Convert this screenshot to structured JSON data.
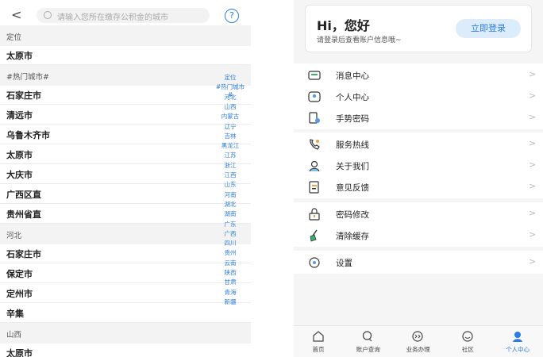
{
  "left": {
    "search": {
      "placeholder": "请输入您所在缴存公积金的城市",
      "help": "?",
      "back": "<"
    },
    "list": [
      {
        "kind": "header",
        "label": "定位"
      },
      {
        "kind": "city",
        "label": "太原市"
      },
      {
        "kind": "header",
        "label": "#热门城市#"
      },
      {
        "kind": "city",
        "label": "石家庄市"
      },
      {
        "kind": "city",
        "label": "清远市"
      },
      {
        "kind": "city",
        "label": "乌鲁木齐市"
      },
      {
        "kind": "city",
        "label": "太原市"
      },
      {
        "kind": "city",
        "label": "大庆市"
      },
      {
        "kind": "city",
        "label": "广西区直"
      },
      {
        "kind": "city",
        "label": "贵州省直"
      },
      {
        "kind": "header",
        "label": "河北"
      },
      {
        "kind": "city",
        "label": "石家庄市"
      },
      {
        "kind": "city",
        "label": "保定市"
      },
      {
        "kind": "city",
        "label": "定州市"
      },
      {
        "kind": "city",
        "label": "辛集"
      },
      {
        "kind": "header",
        "label": "山西"
      },
      {
        "kind": "city",
        "label": "太原市"
      }
    ],
    "index_bar": [
      "定位",
      "#热门城市#",
      "河北",
      "山西",
      "内蒙古",
      "辽宁",
      "吉林",
      "黑龙江",
      "江苏",
      "浙江",
      "江西",
      "山东",
      "河南",
      "湖北",
      "湖南",
      "广东",
      "广西",
      "四川",
      "贵州",
      "云南",
      "陕西",
      "甘肃",
      "青海",
      "新疆"
    ]
  },
  "right": {
    "greeting": "Hi，您好",
    "greeting_sub": "请登录后查看账户信息哦~",
    "login_button": "立即登录",
    "groups": [
      [
        {
          "label": "消息中心",
          "icon": "message-icon"
        },
        {
          "label": "个人中心",
          "icon": "person-icon"
        },
        {
          "label": "手势密码",
          "icon": "gesture-password-icon"
        }
      ],
      [
        {
          "label": "服务热线",
          "icon": "phone-icon"
        },
        {
          "label": "关于我们",
          "icon": "about-icon"
        },
        {
          "label": "意见反馈",
          "icon": "feedback-icon"
        }
      ],
      [
        {
          "label": "密码修改",
          "icon": "lock-icon"
        },
        {
          "label": "清除缓存",
          "icon": "broom-icon"
        }
      ],
      [
        {
          "label": "设置",
          "icon": "settings-icon"
        }
      ]
    ],
    "chevron": ">",
    "tabs": [
      {
        "label": "首页",
        "icon": "home-icon",
        "active": false
      },
      {
        "label": "账户查询",
        "icon": "search-icon",
        "active": false
      },
      {
        "label": "业务办理",
        "icon": "business-icon",
        "active": false
      },
      {
        "label": "社区",
        "icon": "community-icon",
        "active": false
      },
      {
        "label": "个人中心",
        "icon": "user-center-icon",
        "active": true
      }
    ],
    "accent_color": "#2b7de1"
  }
}
